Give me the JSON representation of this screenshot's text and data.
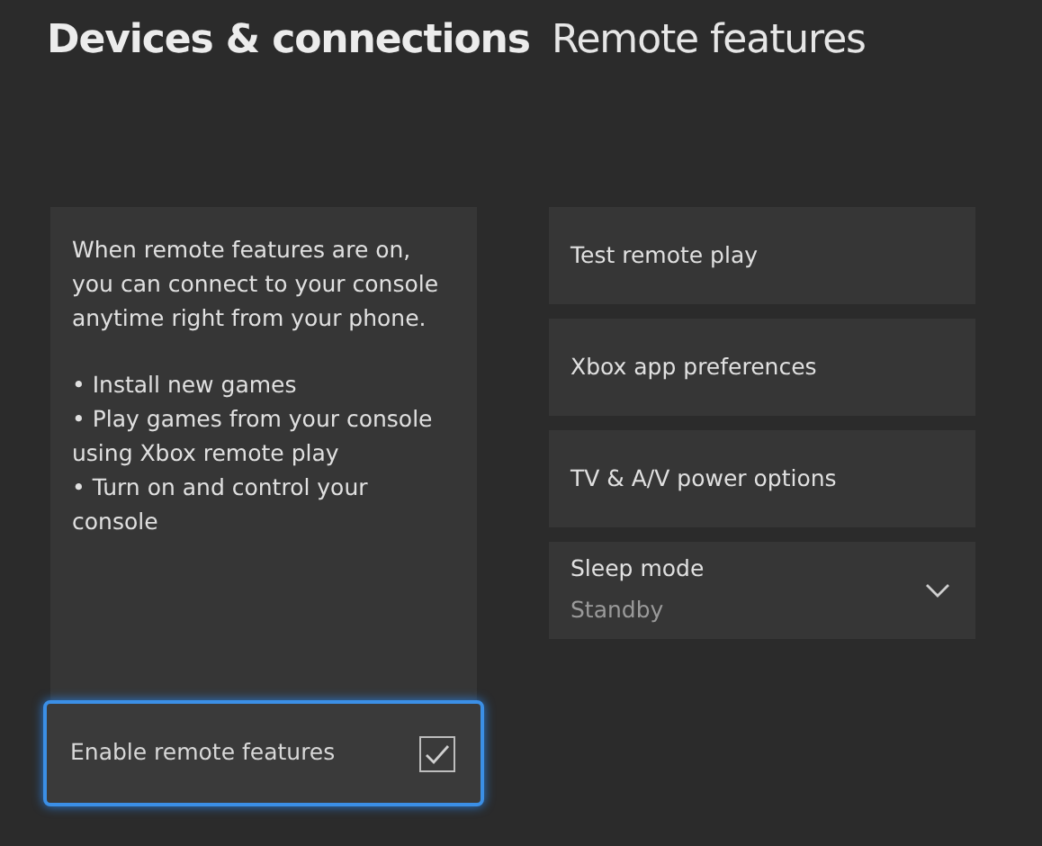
{
  "header": {
    "section": "Devices & connections",
    "page": "Remote features"
  },
  "description": {
    "intro": "When remote features are on, you can connect to your console anytime right from your phone.",
    "bullets": [
      "• Install new games",
      "• Play games from your console using Xbox remote play",
      "• Turn on and control your console"
    ]
  },
  "toggle": {
    "label": "Enable remote features",
    "checked": true,
    "focused": true
  },
  "options": [
    {
      "kind": "button",
      "label": "Test remote play"
    },
    {
      "kind": "button",
      "label": "Xbox app preferences"
    },
    {
      "kind": "button",
      "label": "TV & A/V power options"
    },
    {
      "kind": "dropdown",
      "label": "Sleep mode",
      "value": "Standby"
    }
  ]
}
